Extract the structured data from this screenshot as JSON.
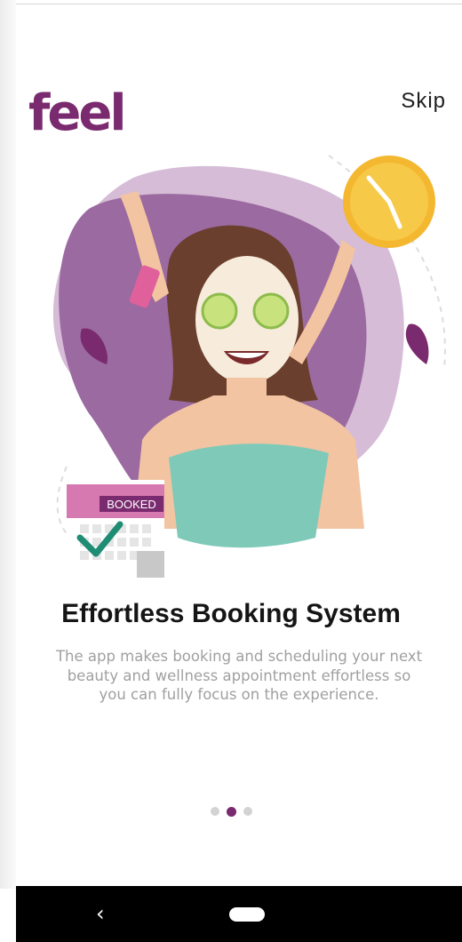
{
  "header": {
    "logo_text": "feel",
    "skip_label": "Skip"
  },
  "onboarding": {
    "illustration_label": "BOOKED",
    "title": "Effortless Booking System",
    "description": "The app makes booking and scheduling your next beauty and wellness appointment effortless so you can fully focus on the experience."
  },
  "pager": {
    "page_count": 3,
    "current_page": 2
  },
  "colors": {
    "brand": "#7a2a6e",
    "blob": "#c9a8cb",
    "inner_blob": "#9b6aa0",
    "clock": "#f4b830",
    "towel": "#7fc9b9",
    "check": "#1f8c74"
  },
  "nav": {
    "back_icon": "chevron-left-icon",
    "home_icon": "home-pill-icon"
  }
}
